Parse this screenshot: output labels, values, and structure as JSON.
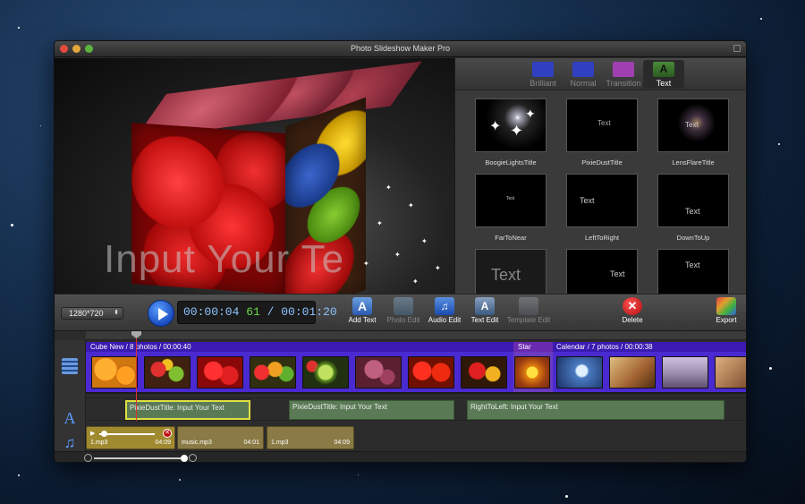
{
  "window": {
    "title": "Photo Slideshow Maker Pro"
  },
  "preview": {
    "overlay_text": "Input Your Te"
  },
  "effect_tabs": [
    {
      "label": "Brilliant",
      "color": "#3040c0"
    },
    {
      "label": "Normal",
      "color": "#3040c0"
    },
    {
      "label": "Transition",
      "color": "#a040b0"
    },
    {
      "label": "Text",
      "color": "#3a7a30",
      "active": true
    }
  ],
  "text_effects": [
    {
      "caption": "BoogieLightsTitle"
    },
    {
      "caption": "PixieDustTitle",
      "thumb_text": "Text"
    },
    {
      "caption": "LensFlareTitle",
      "thumb_text": "Text"
    },
    {
      "caption": "FarToNear",
      "thumb_text": "Text"
    },
    {
      "caption": "LeftToRight",
      "thumb_text": "Text"
    },
    {
      "caption": "DownToUp",
      "thumb_text": "Text"
    },
    {
      "caption": "",
      "thumb_text": "Text"
    },
    {
      "caption": "",
      "thumb_text": "Text"
    },
    {
      "caption": "",
      "thumb_text": "Text"
    }
  ],
  "toolbar": {
    "resolution": "1280*720",
    "time_current": "00:00:04",
    "time_frames": "61",
    "time_total": "/ 00:01:20",
    "add_text": "Add Text",
    "photo_edit": "Photo Edit",
    "audio_edit": "Audio Edit",
    "text_edit": "Text Edit",
    "template_edit": "Template Edit",
    "delete": "Delete",
    "export": "Export"
  },
  "timeline": {
    "groups": [
      {
        "label": "Cube New / 8 photos / 00:00:40"
      },
      {
        "label": "Star"
      },
      {
        "label": "Calendar / 7 photos / 00:00:38"
      }
    ],
    "text_clips": [
      {
        "label": "PixieDustTitle: Input Your Text"
      },
      {
        "label": "PixieDustTitle: Input Your Text"
      },
      {
        "label": "RightToLeft: Input Your Text"
      }
    ],
    "audio_clips": [
      {
        "name": "1.mp3",
        "duration": "04:09"
      },
      {
        "name": "music.mp3",
        "duration": "04:01"
      },
      {
        "name": "1.mp3",
        "duration": "04:09"
      }
    ]
  }
}
